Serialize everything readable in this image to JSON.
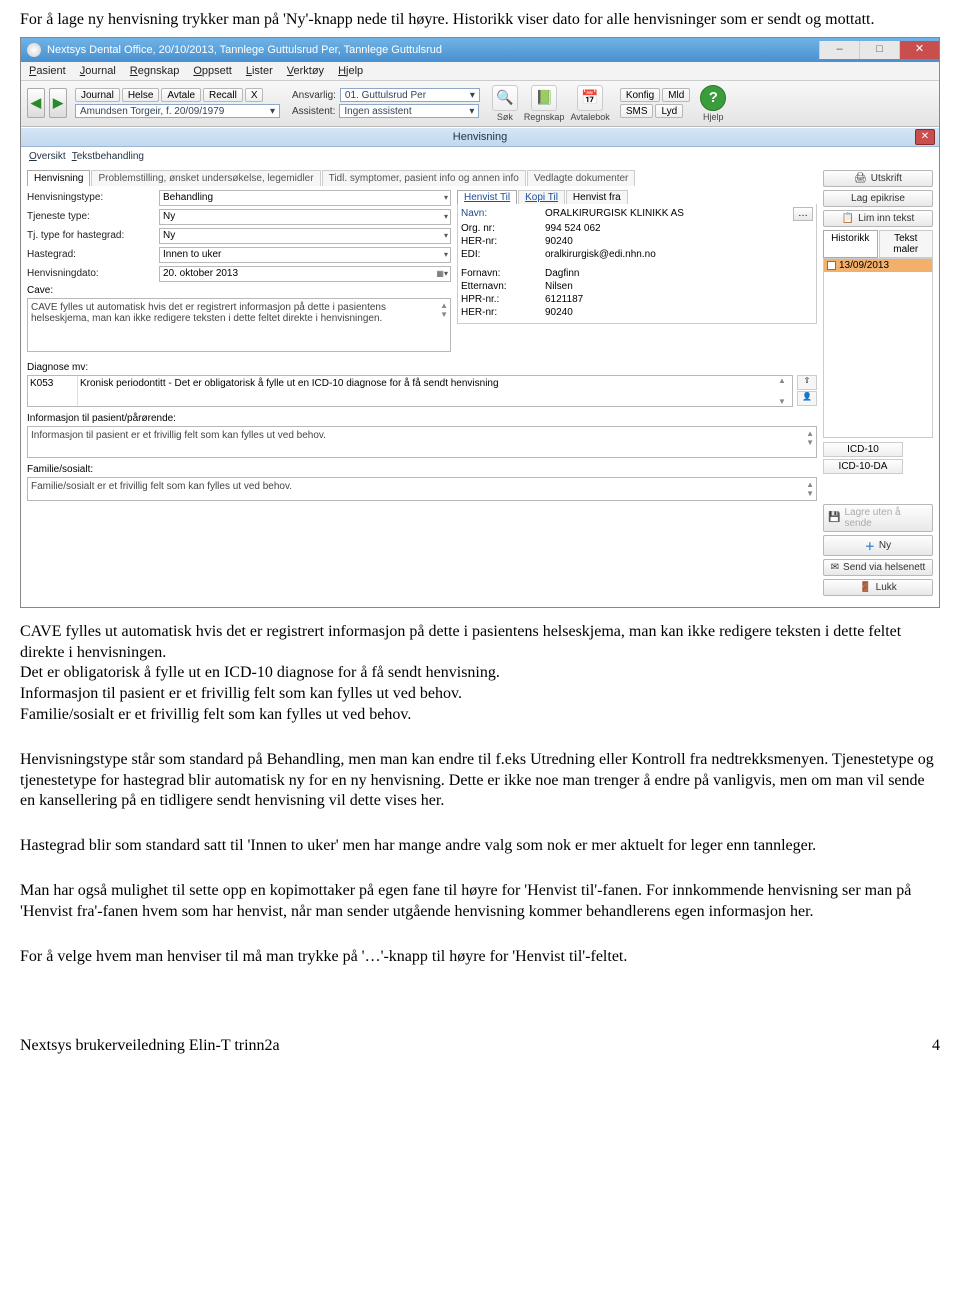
{
  "intro": "For å lage ny henvisning trykker man på 'Ny'-knapp nede til høyre. Historikk viser dato for alle henvisninger som er sendt og mottatt.",
  "titlebar": "Nextsys Dental Office,  20/10/2013, Tannlege Guttulsrud Per,  Tannlege Guttulsrud",
  "menubar": [
    "Pasient",
    "Journal",
    "Regnskap",
    "Oppsett",
    "Lister",
    "Verktøy",
    "Hjelp"
  ],
  "toolbar": {
    "group1": [
      "Journal",
      "Helse",
      "Avtale",
      "Recall",
      "X"
    ],
    "patient_line": "Amundsen Torgeir, f. 20/09/1979",
    "ansvarlig_label": "Ansvarlig:",
    "ansvarlig_value": "01. Guttulsrud Per",
    "assistent_label": "Assistent:",
    "assistent_value": "Ingen assistent",
    "action_cols": [
      {
        "name": "search",
        "label": "Søk",
        "glyph": "🔍"
      },
      {
        "name": "regnskap",
        "label": "Regnskap",
        "glyph": "📗"
      },
      {
        "name": "avtalebok",
        "label": "Avtalebok",
        "glyph": "📅"
      }
    ],
    "konfig": "Konfig",
    "mld": "Mld",
    "sms": "SMS",
    "lyd": "Lyd",
    "hjelp": "Hjelp"
  },
  "henvisning_title": "Henvisning",
  "top_tabs": [
    "Oversikt",
    "Tekstbehandling"
  ],
  "main_tabs": [
    "Henvisning",
    "Problemstilling, ønsket undersøkelse, legemidler",
    "Tidl. symptomer, pasient info og annen info",
    "Vedlagte dokumenter"
  ],
  "form": {
    "henvisningstype_label": "Henvisningstype:",
    "henvisningstype": "Behandling",
    "tjeneste_label": "Tjeneste type:",
    "tjeneste": "Ny",
    "tj_haste_label": "Tj. type for hastegrad:",
    "tj_haste": "Ny",
    "hastegrad_label": "Hastegrad:",
    "hastegrad": "Innen to uker",
    "dato_label": "Henvisningdato:",
    "dato": "20.   oktober   2013",
    "cave_label": "Cave:",
    "cave_text": "CAVE fylles ut automatisk hvis det er registrert informasjon på dette i pasientens helseskjema, man kan ikke redigere teksten i dette feltet direkte i henvisningen.",
    "diag_label": "Diagnose mv:",
    "diag_code": "K053",
    "diag_text": "Kronisk periodontitt - Det er obligatorisk å fylle ut en ICD-10 diagnose for å få sendt henvisning",
    "info_label": "Informasjon til pasient/pårørende:",
    "info_text": "Informasjon til pasient er et frivillig felt som kan fylles ut ved behov.",
    "fam_label": "Familie/sosialt:",
    "fam_text": "Familie/sosialt er et frivillig felt som kan fylles ut ved behov."
  },
  "henvist": {
    "tabs": [
      "Henvist Til",
      "Kopi Til",
      "Henvist fra"
    ],
    "navn_label": "Navn:",
    "navn": "ORALKIRURGISK KLINIKK AS",
    "org_label": "Org. nr:",
    "org": "994 524 062",
    "her_label": "HER-nr:",
    "her": "90240",
    "edi_label": "EDI:",
    "edi": "oralkirurgisk@edi.nhn.no",
    "fornavn_label": "Fornavn:",
    "fornavn": "Dagfinn",
    "etternavn_label": "Etternavn:",
    "etternavn": "Nilsen",
    "hpr_label": "HPR-nr.:",
    "hpr": "6121187",
    "her2_label": "HER-nr:",
    "her2": "90240"
  },
  "side": {
    "utskrift": "Utskrift",
    "epikrise": "Lag epikrise",
    "lim": "Lim inn tekst",
    "historikk": "Historikk",
    "tekstmaler": "Tekst maler",
    "hist_date": "13/09/2013",
    "icd10": "ICD-10",
    "icd10da": "ICD-10-DA",
    "lagre": "Lagre uten å sende",
    "ny": "Ny",
    "send": "Send via helsenett",
    "lukk": "Lukk"
  },
  "body_paragraphs": [
    "CAVE fylles ut automatisk hvis det er registrert informasjon på dette i pasientens helseskjema, man kan ikke redigere teksten i dette feltet direkte i henvisningen.\nDet er obligatorisk å fylle ut en ICD-10 diagnose for å få sendt henvisning.\nInformasjon til pasient er et frivillig felt som kan fylles ut ved behov.\nFamilie/sosialt er et frivillig felt som kan fylles ut ved behov.",
    "Henvisningstype står som standard på Behandling, men man kan endre til f.eks Utredning eller Kontroll fra nedtrekksmenyen. Tjenestetype og tjenestetype for hastegrad blir automatisk ny for en ny henvisning. Dette er ikke noe man trenger å endre på vanligvis, men om man vil sende en kansellering på en tidligere sendt henvisning vil dette vises her.",
    "Hastegrad blir som standard satt til 'Innen to uker' men har mange andre valg som nok er mer aktuelt for leger enn tannleger.",
    "Man har også mulighet til sette opp en kopimottaker på egen fane til høyre for 'Henvist til'-fanen. For innkommende henvisning ser man på 'Henvist fra'-fanen hvem som har henvist, når man sender utgående henvisning kommer behandlerens egen informasjon her.",
    "For å velge hvem man henviser til må man trykke på '…'-knapp til høyre for 'Henvist til'-feltet."
  ],
  "footer_left": "Nextsys brukerveiledning Elin-T trinn2a",
  "footer_right": "4"
}
